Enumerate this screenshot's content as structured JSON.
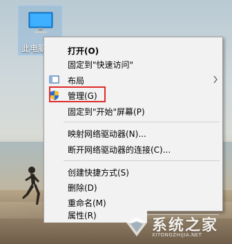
{
  "desktop": {
    "icon_label": "此电脑"
  },
  "context_menu": {
    "items": [
      {
        "label": "打开(O)",
        "bold": true
      },
      {
        "label": "固定到\"快速访问\""
      },
      {
        "label": "布局",
        "icon": "layout-icon",
        "submenu": true
      },
      {
        "label": "管理(G)",
        "icon": "shield-icon",
        "highlighted": true
      },
      {
        "label": "固定到\"开始\"屏幕(P)"
      },
      {
        "label": "映射网络驱动器(N)..."
      },
      {
        "label": "断开网络驱动器的连接(C)..."
      },
      {
        "label": "创建快捷方式(S)"
      },
      {
        "label": "删除(D)"
      },
      {
        "label": "重命名(M)"
      },
      {
        "label": "属性(R)"
      }
    ],
    "highlight_color": "#e02b2b"
  },
  "watermark": {
    "text": "系统之家",
    "url": "XITONGZHIJIA.NET"
  }
}
